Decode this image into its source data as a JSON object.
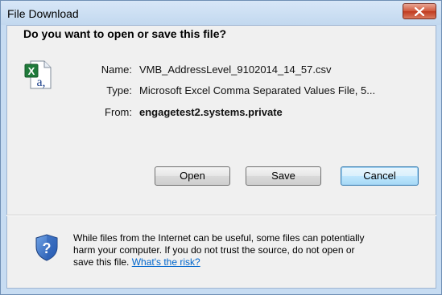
{
  "window": {
    "title": "File Download"
  },
  "dialog": {
    "question": "Do you want to open or save this file?",
    "fields": {
      "name_label": "Name:",
      "name_value": "VMB_AddressLevel_9102014_14_57.csv",
      "type_label": "Type:",
      "type_value": "Microsoft Excel Comma Separated Values File, 5...",
      "from_label": "From:",
      "from_value": "engagetest2.systems.private"
    },
    "buttons": {
      "open": "Open",
      "save": "Save",
      "cancel": "Cancel"
    },
    "warning": {
      "line1": "While files from the Internet can be useful, some files can potentially",
      "line2": "harm your computer. If you do not trust the source, do not open or",
      "line3": "save this file.",
      "link": "What's the risk?"
    }
  },
  "icons": {
    "file": "excel-csv-file-icon",
    "warning": "security-shield-question-icon",
    "close": "close-icon"
  },
  "colors": {
    "link": "#0066cc",
    "close_button": "#c94a2e",
    "title_bar": "#c7dcf2"
  }
}
